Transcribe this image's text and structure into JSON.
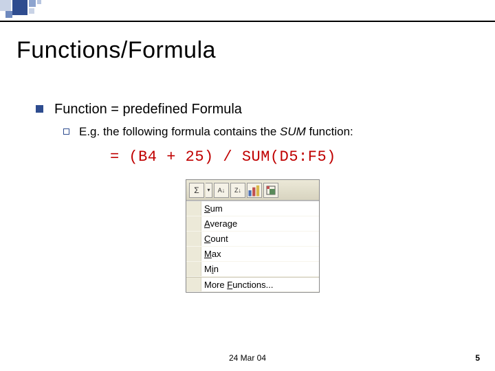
{
  "slide": {
    "title": "Functions/Formula",
    "bullet1": "Function = predefined Formula",
    "bullet2_prefix": "E.g. the following formula contains the ",
    "bullet2_em": "SUM",
    "bullet2_suffix": " function:",
    "formula": "= (B4 + 25) / SUM(D5:F5)"
  },
  "toolbar": {
    "autosum_glyph": "Σ",
    "sort_asc_glyph": "A↓",
    "sort_desc_glyph": "Z↓",
    "chart_glyph": "📊",
    "dropdown_glyph": "▾"
  },
  "menu": {
    "items": [
      {
        "pre": "",
        "u": "S",
        "post": "um"
      },
      {
        "pre": "",
        "u": "A",
        "post": "verage"
      },
      {
        "pre": "",
        "u": "C",
        "post": "ount"
      },
      {
        "pre": "",
        "u": "M",
        "post": "ax"
      },
      {
        "pre": "M",
        "u": "i",
        "post": "n"
      },
      {
        "pre": "More ",
        "u": "F",
        "post": "unctions..."
      }
    ]
  },
  "footer": {
    "date": "24 Mar 04",
    "page": "5"
  }
}
